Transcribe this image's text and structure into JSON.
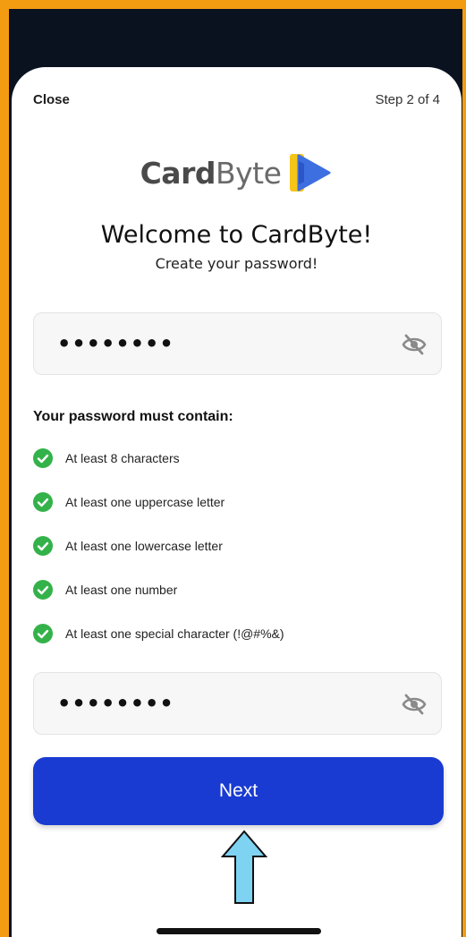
{
  "header": {
    "close_label": "Close",
    "step_label": "Step 2 of 4"
  },
  "logo": {
    "bold": "Card",
    "light": "Byte",
    "mark_icon": "cardbyte-play-logo-icon",
    "colors": {
      "yellow": "#f5c518",
      "blue": "#3d6fe0"
    }
  },
  "welcome": {
    "title": "Welcome to CardByte!",
    "subtitle": "Create your password!"
  },
  "password": {
    "value": "••••••••",
    "toggle_icon": "eye-slash-icon"
  },
  "requirements": {
    "title": "Your password must contain:",
    "items": [
      {
        "label": "At least 8 characters",
        "met": true
      },
      {
        "label": "At least one uppercase letter",
        "met": true
      },
      {
        "label": "At least one lowercase letter",
        "met": true
      },
      {
        "label": "At least one number",
        "met": true
      },
      {
        "label": "At least one special character (!@#%&)",
        "met": true
      }
    ],
    "check_icon": "check-circle-icon",
    "check_color": "#34b24a"
  },
  "confirm_password": {
    "value": "••••••••",
    "toggle_icon": "eye-slash-icon"
  },
  "next_button": {
    "label": "Next",
    "color": "#1a3bd1"
  },
  "annotation": {
    "arrow_icon": "up-arrow-icon",
    "arrow_color": "#7fd3f2"
  },
  "colors": {
    "frame_border": "#f39c12",
    "backdrop": "#0a1220"
  }
}
